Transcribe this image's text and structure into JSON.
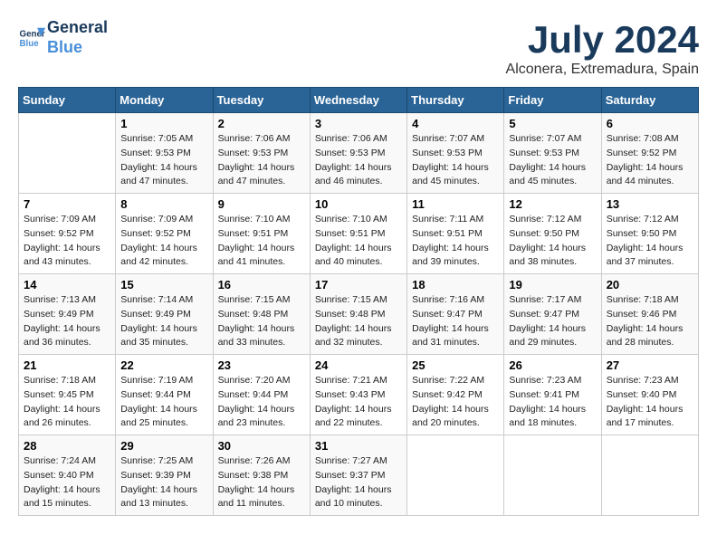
{
  "logo": {
    "line1": "General",
    "line2": "Blue"
  },
  "title": "July 2024",
  "subtitle": "Alconera, Extremadura, Spain",
  "header": {
    "accent_color": "#2a6496"
  },
  "days_of_week": [
    "Sunday",
    "Monday",
    "Tuesday",
    "Wednesday",
    "Thursday",
    "Friday",
    "Saturday"
  ],
  "weeks": [
    [
      {
        "day": "",
        "sunrise": "",
        "sunset": "",
        "daylight": ""
      },
      {
        "day": "1",
        "sunrise": "Sunrise: 7:05 AM",
        "sunset": "Sunset: 9:53 PM",
        "daylight": "Daylight: 14 hours and 47 minutes."
      },
      {
        "day": "2",
        "sunrise": "Sunrise: 7:06 AM",
        "sunset": "Sunset: 9:53 PM",
        "daylight": "Daylight: 14 hours and 47 minutes."
      },
      {
        "day": "3",
        "sunrise": "Sunrise: 7:06 AM",
        "sunset": "Sunset: 9:53 PM",
        "daylight": "Daylight: 14 hours and 46 minutes."
      },
      {
        "day": "4",
        "sunrise": "Sunrise: 7:07 AM",
        "sunset": "Sunset: 9:53 PM",
        "daylight": "Daylight: 14 hours and 45 minutes."
      },
      {
        "day": "5",
        "sunrise": "Sunrise: 7:07 AM",
        "sunset": "Sunset: 9:53 PM",
        "daylight": "Daylight: 14 hours and 45 minutes."
      },
      {
        "day": "6",
        "sunrise": "Sunrise: 7:08 AM",
        "sunset": "Sunset: 9:52 PM",
        "daylight": "Daylight: 14 hours and 44 minutes."
      }
    ],
    [
      {
        "day": "7",
        "sunrise": "Sunrise: 7:09 AM",
        "sunset": "Sunset: 9:52 PM",
        "daylight": "Daylight: 14 hours and 43 minutes."
      },
      {
        "day": "8",
        "sunrise": "Sunrise: 7:09 AM",
        "sunset": "Sunset: 9:52 PM",
        "daylight": "Daylight: 14 hours and 42 minutes."
      },
      {
        "day": "9",
        "sunrise": "Sunrise: 7:10 AM",
        "sunset": "Sunset: 9:51 PM",
        "daylight": "Daylight: 14 hours and 41 minutes."
      },
      {
        "day": "10",
        "sunrise": "Sunrise: 7:10 AM",
        "sunset": "Sunset: 9:51 PM",
        "daylight": "Daylight: 14 hours and 40 minutes."
      },
      {
        "day": "11",
        "sunrise": "Sunrise: 7:11 AM",
        "sunset": "Sunset: 9:51 PM",
        "daylight": "Daylight: 14 hours and 39 minutes."
      },
      {
        "day": "12",
        "sunrise": "Sunrise: 7:12 AM",
        "sunset": "Sunset: 9:50 PM",
        "daylight": "Daylight: 14 hours and 38 minutes."
      },
      {
        "day": "13",
        "sunrise": "Sunrise: 7:12 AM",
        "sunset": "Sunset: 9:50 PM",
        "daylight": "Daylight: 14 hours and 37 minutes."
      }
    ],
    [
      {
        "day": "14",
        "sunrise": "Sunrise: 7:13 AM",
        "sunset": "Sunset: 9:49 PM",
        "daylight": "Daylight: 14 hours and 36 minutes."
      },
      {
        "day": "15",
        "sunrise": "Sunrise: 7:14 AM",
        "sunset": "Sunset: 9:49 PM",
        "daylight": "Daylight: 14 hours and 35 minutes."
      },
      {
        "day": "16",
        "sunrise": "Sunrise: 7:15 AM",
        "sunset": "Sunset: 9:48 PM",
        "daylight": "Daylight: 14 hours and 33 minutes."
      },
      {
        "day": "17",
        "sunrise": "Sunrise: 7:15 AM",
        "sunset": "Sunset: 9:48 PM",
        "daylight": "Daylight: 14 hours and 32 minutes."
      },
      {
        "day": "18",
        "sunrise": "Sunrise: 7:16 AM",
        "sunset": "Sunset: 9:47 PM",
        "daylight": "Daylight: 14 hours and 31 minutes."
      },
      {
        "day": "19",
        "sunrise": "Sunrise: 7:17 AM",
        "sunset": "Sunset: 9:47 PM",
        "daylight": "Daylight: 14 hours and 29 minutes."
      },
      {
        "day": "20",
        "sunrise": "Sunrise: 7:18 AM",
        "sunset": "Sunset: 9:46 PM",
        "daylight": "Daylight: 14 hours and 28 minutes."
      }
    ],
    [
      {
        "day": "21",
        "sunrise": "Sunrise: 7:18 AM",
        "sunset": "Sunset: 9:45 PM",
        "daylight": "Daylight: 14 hours and 26 minutes."
      },
      {
        "day": "22",
        "sunrise": "Sunrise: 7:19 AM",
        "sunset": "Sunset: 9:44 PM",
        "daylight": "Daylight: 14 hours and 25 minutes."
      },
      {
        "day": "23",
        "sunrise": "Sunrise: 7:20 AM",
        "sunset": "Sunset: 9:44 PM",
        "daylight": "Daylight: 14 hours and 23 minutes."
      },
      {
        "day": "24",
        "sunrise": "Sunrise: 7:21 AM",
        "sunset": "Sunset: 9:43 PM",
        "daylight": "Daylight: 14 hours and 22 minutes."
      },
      {
        "day": "25",
        "sunrise": "Sunrise: 7:22 AM",
        "sunset": "Sunset: 9:42 PM",
        "daylight": "Daylight: 14 hours and 20 minutes."
      },
      {
        "day": "26",
        "sunrise": "Sunrise: 7:23 AM",
        "sunset": "Sunset: 9:41 PM",
        "daylight": "Daylight: 14 hours and 18 minutes."
      },
      {
        "day": "27",
        "sunrise": "Sunrise: 7:23 AM",
        "sunset": "Sunset: 9:40 PM",
        "daylight": "Daylight: 14 hours and 17 minutes."
      }
    ],
    [
      {
        "day": "28",
        "sunrise": "Sunrise: 7:24 AM",
        "sunset": "Sunset: 9:40 PM",
        "daylight": "Daylight: 14 hours and 15 minutes."
      },
      {
        "day": "29",
        "sunrise": "Sunrise: 7:25 AM",
        "sunset": "Sunset: 9:39 PM",
        "daylight": "Daylight: 14 hours and 13 minutes."
      },
      {
        "day": "30",
        "sunrise": "Sunrise: 7:26 AM",
        "sunset": "Sunset: 9:38 PM",
        "daylight": "Daylight: 14 hours and 11 minutes."
      },
      {
        "day": "31",
        "sunrise": "Sunrise: 7:27 AM",
        "sunset": "Sunset: 9:37 PM",
        "daylight": "Daylight: 14 hours and 10 minutes."
      },
      {
        "day": "",
        "sunrise": "",
        "sunset": "",
        "daylight": ""
      },
      {
        "day": "",
        "sunrise": "",
        "sunset": "",
        "daylight": ""
      },
      {
        "day": "",
        "sunrise": "",
        "sunset": "",
        "daylight": ""
      }
    ]
  ]
}
